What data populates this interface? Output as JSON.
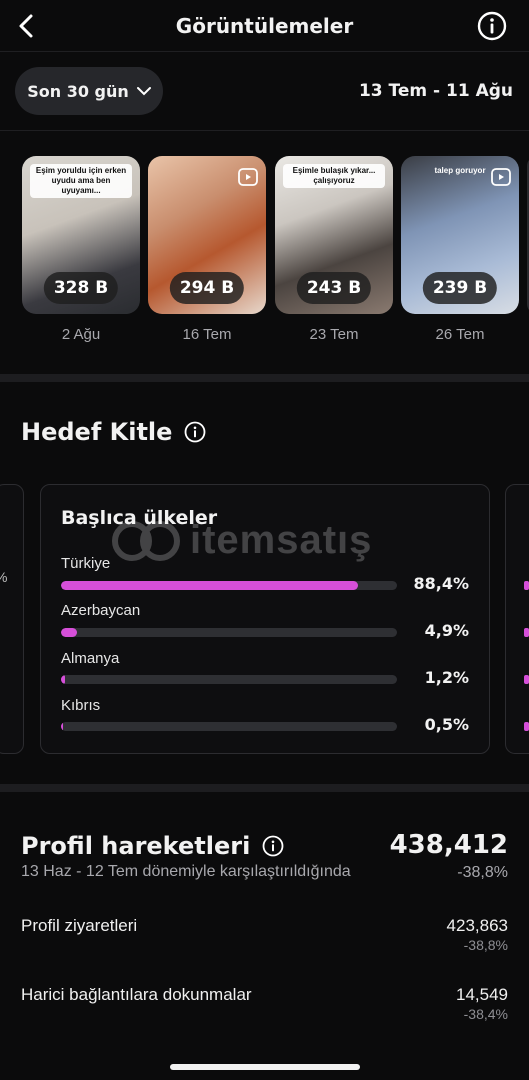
{
  "header": {
    "title": "Görüntülemeler",
    "back_icon": "chevron-left-icon",
    "info_icon": "info-icon"
  },
  "filter": {
    "range_label": "Son 30 gün",
    "date_range": "13 Tem - 11 Ağu"
  },
  "thumbnails": [
    {
      "value": "328 B",
      "date": "2 Ağu",
      "caption": "Eşim yoruldu için erken uyudu ama ben uyuyamı..."
    },
    {
      "value": "294 B",
      "date": "16 Tem",
      "caption": ""
    },
    {
      "value": "243 B",
      "date": "23 Tem",
      "caption": "Eşimle bulaşık yıkar... çalışıyoruz"
    },
    {
      "value": "239 B",
      "date": "26 Tem",
      "caption": "talep goruyor"
    }
  ],
  "audience": {
    "title": "Hedef Kitle",
    "countries_card": {
      "title": "Başlıca ülkeler",
      "rows": [
        {
          "label": "Türkiye",
          "value": "88,4%",
          "pct": 88.4
        },
        {
          "label": "Azerbaycan",
          "value": "4,9%",
          "pct": 4.9
        },
        {
          "label": "Almanya",
          "value": "1,2%",
          "pct": 1.2
        },
        {
          "label": "Kıbrıs",
          "value": "0,5%",
          "pct": 0.5
        }
      ]
    },
    "accent_color": "#d64fd9"
  },
  "watermark": {
    "text": "itemsatış"
  },
  "profile_activity": {
    "title": "Profil hareketleri",
    "total": "438,412",
    "subtitle": "13 Haz - 12 Tem dönemiyle karşılaştırıldığında",
    "change": "-38,8%",
    "metrics": [
      {
        "label": "Profil ziyaretleri",
        "value": "423,863",
        "change": "-38,8%"
      },
      {
        "label": "Harici bağlantılara dokunmalar",
        "value": "14,549",
        "change": "-38,4%"
      }
    ]
  }
}
